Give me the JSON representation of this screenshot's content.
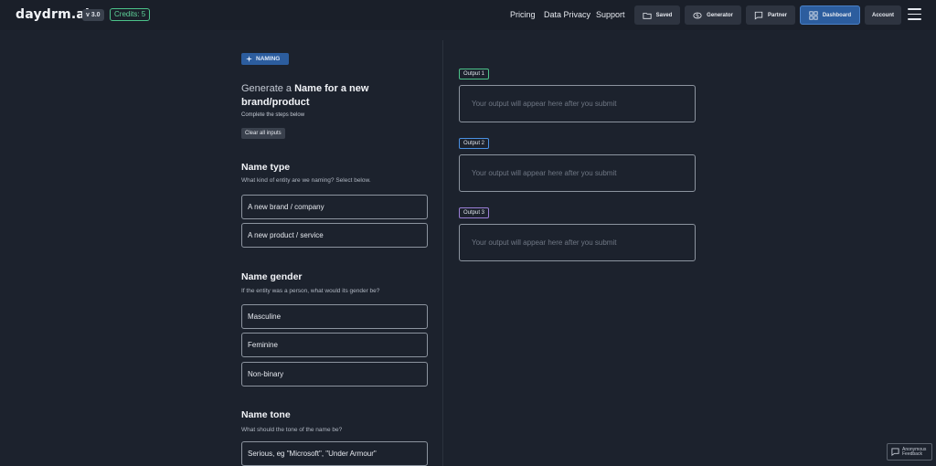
{
  "header": {
    "logo": "daydrm.ai",
    "version": "v 3.0",
    "credits": "Credits: 5",
    "links": [
      "Pricing",
      "Data Privacy",
      "Support"
    ],
    "buttons": {
      "saved": "Saved",
      "generator": "Generator",
      "partner": "Partner",
      "dashboard": "Dashboard",
      "account": "Account"
    }
  },
  "form": {
    "badge": "NAMING",
    "headline_prefix": "Generate a",
    "headline_bold": "Name for a new brand/product",
    "subhead": "Complete the steps below",
    "clear_label": "Clear all inputs",
    "sections": [
      {
        "title": "Name type",
        "desc": "What kind of entity are we naming? Select below.",
        "options": [
          "A new brand / company",
          "A new product / service"
        ]
      },
      {
        "title": "Name gender",
        "desc": "If the entity was a person, what would its gender be?",
        "options": [
          "Masculine",
          "Feminine",
          "Non-binary"
        ]
      },
      {
        "title": "Name tone",
        "desc": "What should the tone of the name be?",
        "options": [
          "Serious, eg \"Microsoft\", \"Under Armour\""
        ]
      }
    ]
  },
  "outputs": [
    {
      "label": "Output 1",
      "placeholder": "Your output will appear here after you submit",
      "color": "#4cc38a"
    },
    {
      "label": "Output 2",
      "placeholder": "Your output will appear here after you submit",
      "color": "#4a90e2"
    },
    {
      "label": "Output 3",
      "placeholder": "Your output will appear here after you submit",
      "color": "#9b7fd6"
    }
  ],
  "feedback": {
    "line1": "Anonymous",
    "line2": "Feedback"
  },
  "colors": {
    "accent": "#2c5d9e",
    "credits": "#4cc38a",
    "background": "#1c222d"
  }
}
